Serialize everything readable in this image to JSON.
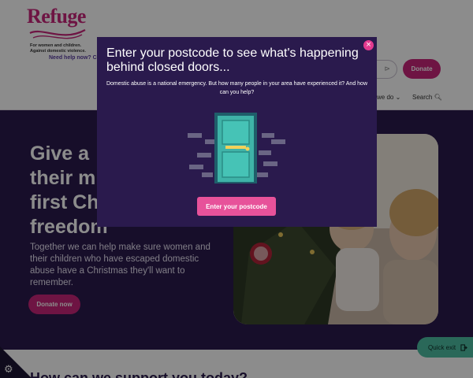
{
  "header": {
    "logo_text": "Refuge",
    "tagline_line1": "For women and children.",
    "tagline_line2": "Against domestic violence.",
    "help_link": "Need help now? Co",
    "exit_label": "⊳",
    "donate_label": "Donate",
    "nav_what_we_do": "we do ⌄",
    "nav_search": "Search 🔍︎"
  },
  "hero": {
    "title_lines": [
      "Give a",
      "their m",
      "first Ch",
      "freedom"
    ],
    "body": "Together we can help make sure women and their children who have escaped domestic abuse have a Christmas they'll want to remember.",
    "donate_label": "Donate now"
  },
  "support": {
    "heading": "How can we support you today?"
  },
  "quick_exit": {
    "label": "Quick exit",
    "icon": "exit-icon"
  },
  "cookie": {
    "icon": "gear-icon"
  },
  "modal": {
    "title": "Enter your postcode to see what's happening behind closed doors...",
    "body": "Domestic abuse is a national emergency. But how many people in your area have experienced it? And how can you help?",
    "cta_label": "Enter your postcode",
    "close_icon": "close-icon",
    "close_glyph": "×"
  },
  "colors": {
    "brand_pink": "#c8267a",
    "dark_purple": "#2a1a4d",
    "cta_pink": "#e7529a",
    "door_teal": "#3fb3a8",
    "quick_exit_green": "#4dbda2"
  }
}
